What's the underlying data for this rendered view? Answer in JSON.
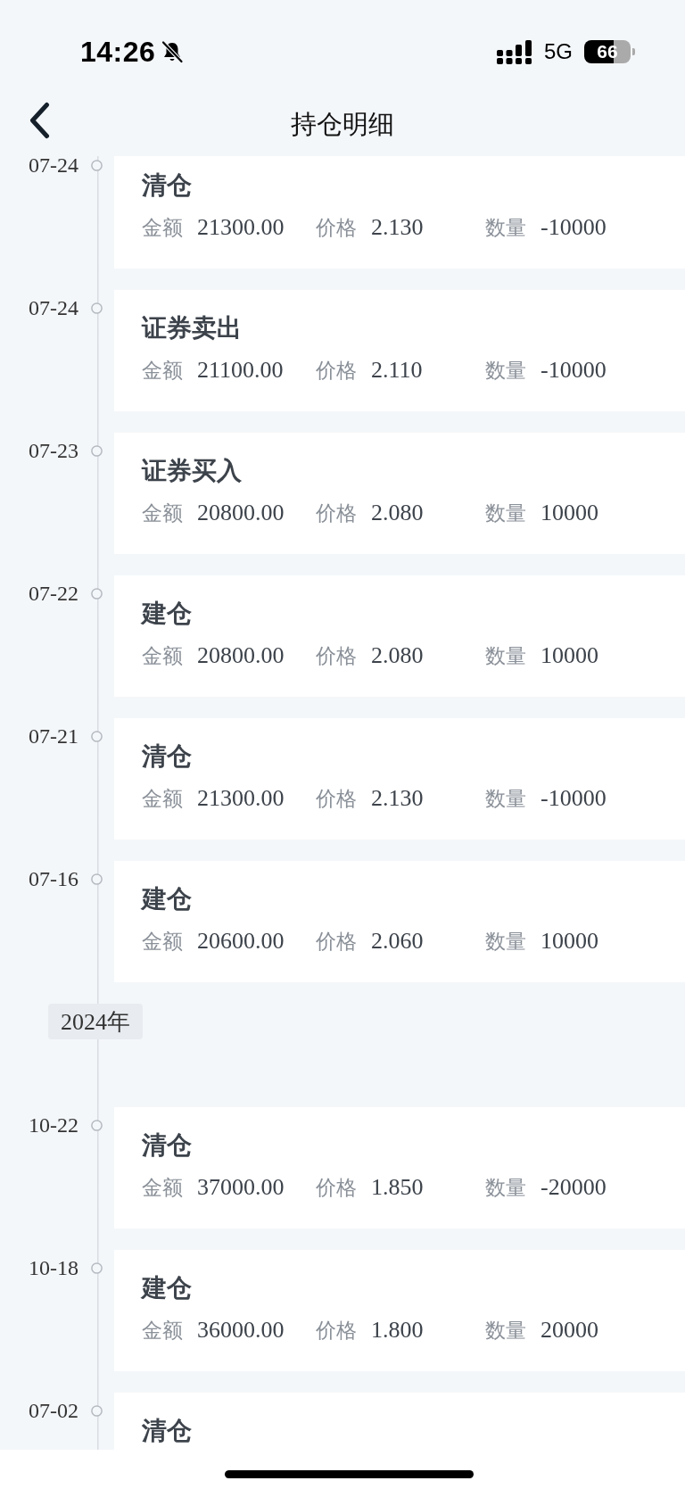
{
  "status_bar": {
    "time": "14:26",
    "network": "5G",
    "battery": "66"
  },
  "header": {
    "title": "持仓明细"
  },
  "timeline": [
    {
      "kind": "record",
      "date": "07-24",
      "title": "清仓",
      "fields": [
        {
          "label": "金额",
          "value": "21300.00"
        },
        {
          "label": "价格",
          "value": "2.130"
        },
        {
          "label": "数量",
          "value": "-10000"
        }
      ]
    },
    {
      "kind": "record",
      "date": "07-24",
      "title": "证券卖出",
      "fields": [
        {
          "label": "金额",
          "value": "21100.00"
        },
        {
          "label": "价格",
          "value": "2.110"
        },
        {
          "label": "数量",
          "value": "-10000"
        }
      ]
    },
    {
      "kind": "record",
      "date": "07-23",
      "title": "证券买入",
      "fields": [
        {
          "label": "金额",
          "value": "20800.00"
        },
        {
          "label": "价格",
          "value": "2.080"
        },
        {
          "label": "数量",
          "value": "10000"
        }
      ]
    },
    {
      "kind": "record",
      "date": "07-22",
      "title": "建仓",
      "fields": [
        {
          "label": "金额",
          "value": "20800.00"
        },
        {
          "label": "价格",
          "value": "2.080"
        },
        {
          "label": "数量",
          "value": "10000"
        }
      ]
    },
    {
      "kind": "record",
      "date": "07-21",
      "title": "清仓",
      "fields": [
        {
          "label": "金额",
          "value": "21300.00"
        },
        {
          "label": "价格",
          "value": "2.130"
        },
        {
          "label": "数量",
          "value": "-10000"
        }
      ]
    },
    {
      "kind": "record",
      "date": "07-16",
      "title": "建仓",
      "fields": [
        {
          "label": "金额",
          "value": "20600.00"
        },
        {
          "label": "价格",
          "value": "2.060"
        },
        {
          "label": "数量",
          "value": "10000"
        }
      ]
    },
    {
      "kind": "year",
      "label": "2024年"
    },
    {
      "kind": "record",
      "date": "10-22",
      "title": "清仓",
      "fields": [
        {
          "label": "金额",
          "value": "37000.00"
        },
        {
          "label": "价格",
          "value": "1.850"
        },
        {
          "label": "数量",
          "value": "-20000"
        }
      ]
    },
    {
      "kind": "record",
      "date": "10-18",
      "title": "建仓",
      "fields": [
        {
          "label": "金额",
          "value": "36000.00"
        },
        {
          "label": "价格",
          "value": "1.800"
        },
        {
          "label": "数量",
          "value": "20000"
        }
      ]
    },
    {
      "kind": "record",
      "date": "07-02",
      "title": "清仓"
    }
  ]
}
